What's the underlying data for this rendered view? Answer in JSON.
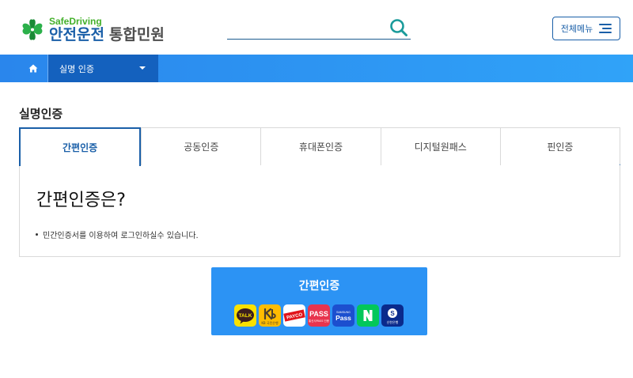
{
  "header": {
    "logo": {
      "sub": "SafeDriving",
      "brand": "안전운전",
      "suffix": "통합민원"
    },
    "search": {
      "placeholder": ""
    },
    "menu_button": {
      "label": "전체메뉴"
    }
  },
  "navbar": {
    "current": "실명 인증"
  },
  "page": {
    "title": "실명인증"
  },
  "tabs": [
    {
      "label": "간편인증",
      "active": true
    },
    {
      "label": "공동인증",
      "active": false
    },
    {
      "label": "휴대폰인증",
      "active": false
    },
    {
      "label": "디지털원패스",
      "active": false
    },
    {
      "label": "핀인증",
      "active": false
    }
  ],
  "panel": {
    "title": "간편인증은?",
    "bullet": "민간인증서를 이용하여 로그인하실수 있습니다."
  },
  "auth_button": {
    "label": "간편인증",
    "providers": [
      {
        "name": "kakao-icon",
        "text": "TALK"
      },
      {
        "name": "kb-icon",
        "text": "KB 국민은행"
      },
      {
        "name": "payco-icon",
        "text": "PAYCO"
      },
      {
        "name": "pass-icon",
        "text": "PASS",
        "sub": "통신사PASS 인증"
      },
      {
        "name": "samsung-pass-icon",
        "text": "Pass",
        "sub": "SAMSUNG"
      },
      {
        "name": "naver-icon",
        "text": "N"
      },
      {
        "name": "shinhan-icon",
        "text": "S",
        "sub": "신한은행"
      }
    ]
  },
  "colors": {
    "primary": "#1a5fa8",
    "nav_gradient_start": "#2a86ec",
    "nav_gradient_end": "#30a3f8",
    "nav_active": "#1461be",
    "auth_button": "#2c93f4",
    "logo_green": "#43b02a"
  }
}
